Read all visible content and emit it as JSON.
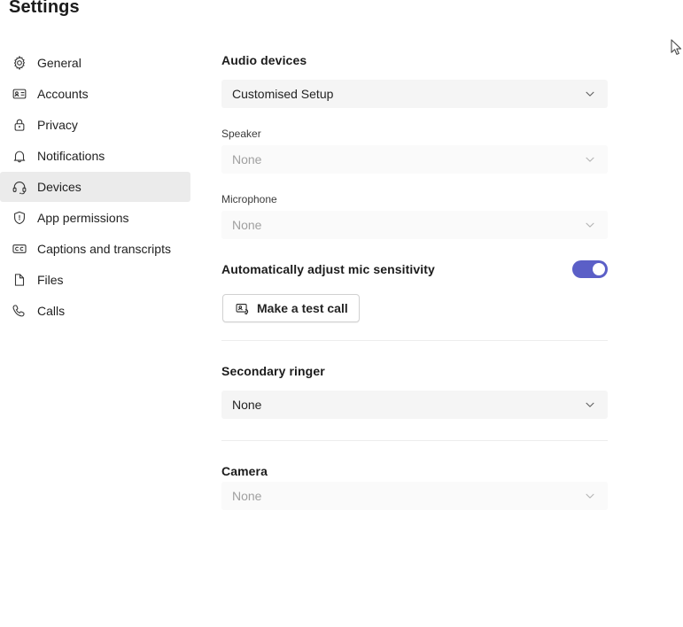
{
  "page": {
    "title": "Settings"
  },
  "sidebar": {
    "items": [
      {
        "label": "General",
        "icon": "gear-icon",
        "selected": false
      },
      {
        "label": "Accounts",
        "icon": "contact-card-icon",
        "selected": false
      },
      {
        "label": "Privacy",
        "icon": "lock-icon",
        "selected": false
      },
      {
        "label": "Notifications",
        "icon": "bell-icon",
        "selected": false
      },
      {
        "label": "Devices",
        "icon": "headset-icon",
        "selected": true
      },
      {
        "label": "App permissions",
        "icon": "shield-icon",
        "selected": false
      },
      {
        "label": "Captions and transcripts",
        "icon": "closed-caption-icon",
        "selected": false
      },
      {
        "label": "Files",
        "icon": "file-icon",
        "selected": false
      },
      {
        "label": "Calls",
        "icon": "phone-icon",
        "selected": false
      }
    ]
  },
  "main": {
    "audio_devices": {
      "heading": "Audio devices",
      "setup_value": "Customised Setup",
      "speaker_label": "Speaker",
      "speaker_value": "None",
      "microphone_label": "Microphone",
      "microphone_value": "None"
    },
    "mic_sensitivity": {
      "label": "Automatically adjust mic sensitivity",
      "state": "on"
    },
    "test_call": {
      "label": "Make a test call",
      "icon": "test-call-icon"
    },
    "secondary_ringer": {
      "heading": "Secondary ringer",
      "value": "None"
    },
    "camera": {
      "heading": "Camera",
      "value": "None"
    }
  },
  "colors": {
    "accent": "#5b5fc7",
    "selected_nav_bg": "#ebebeb",
    "field_bg": "#f5f5f5",
    "field_bg_disabled": "#fafafa",
    "divider": "#ededed"
  }
}
